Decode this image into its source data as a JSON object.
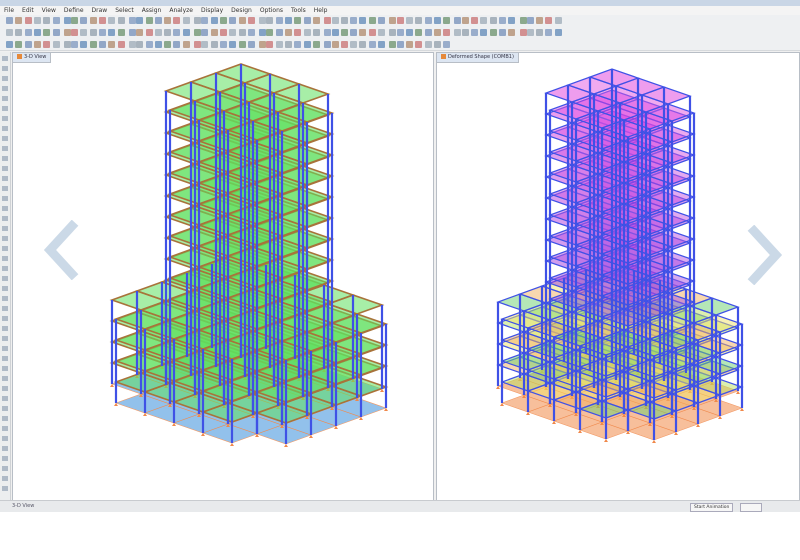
{
  "menu": [
    "File",
    "Edit",
    "View",
    "Define",
    "Draw",
    "Select",
    "Assign",
    "Analyze",
    "Display",
    "Design",
    "Options",
    "Tools",
    "Help"
  ],
  "panes": {
    "left_title": "3-D View",
    "right_title": "Deformed Shape (COMB1)"
  },
  "statusbar": {
    "left_text": "3-D View",
    "start_animation_label": "Start Animation"
  },
  "colors": {
    "slab_green": "#5fe05f",
    "column_blue": "#3f51e6",
    "beam_brown": "#a8733a",
    "support_orange": "#f0884a",
    "contour_magenta": "#d23bd6",
    "contour_yellow": "#f2e36a",
    "nav_arrow": "#c5d5e4"
  },
  "icons": {
    "prev": "chevron-left-icon",
    "next": "chevron-right-icon"
  }
}
